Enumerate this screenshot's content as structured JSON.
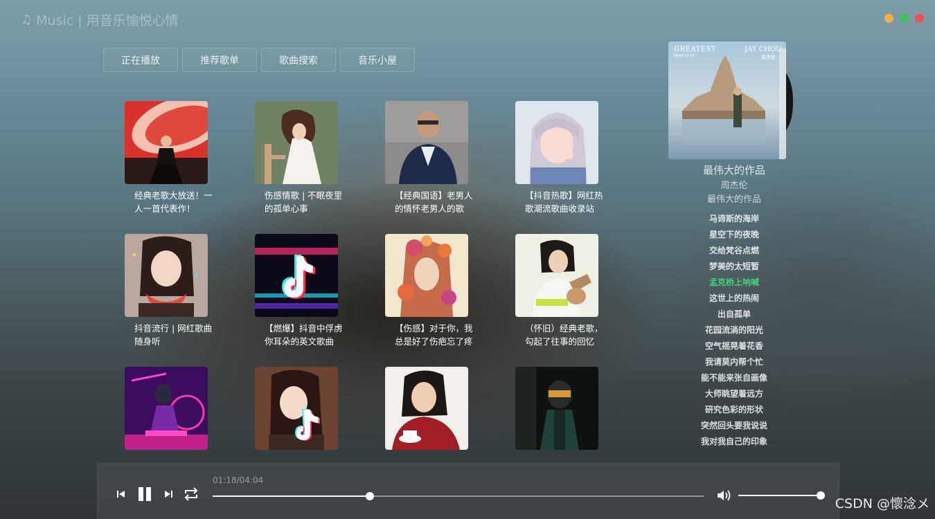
{
  "app": {
    "title": "Music | 用音乐愉悦心情",
    "window_controls": [
      "minimize",
      "maximize",
      "close"
    ]
  },
  "tabs": [
    {
      "label": "正在播放"
    },
    {
      "label": "推荐歌单"
    },
    {
      "label": "歌曲搜索"
    },
    {
      "label": "音乐小屋"
    }
  ],
  "playlists": [
    {
      "title": "经典老歌大放送！一人一首代表作！"
    },
    {
      "title": "伤感情歌 | 不眠夜里的孤单心事"
    },
    {
      "title": "【经典国语】老男人的情怀老男人的歌"
    },
    {
      "title": "【抖音热歌】网红热歌潮流歌曲收录站"
    },
    {
      "title": "抖音流行 | 网红歌曲随身听"
    },
    {
      "title": "【燃爆】抖音中俘虏你耳朵的英文歌曲"
    },
    {
      "title": "【伤感】对于你，我总是好了伤疤忘了疼"
    },
    {
      "title": "（怀旧）经典老歌，勾起了往事的回忆"
    },
    {
      "title": ""
    },
    {
      "title": ""
    },
    {
      "title": ""
    },
    {
      "title": ""
    }
  ],
  "now_playing": {
    "cover_text_left": "GREATEST",
    "cover_subtext_left": "WORKS OF ART",
    "cover_text_right": "JAY CHOU",
    "cover_subtext_right": "周杰伦",
    "title": "最伟大的作品",
    "artist": "周杰伦",
    "album": "最伟大的作品"
  },
  "song_list": [
    {
      "name": "马谛斯的海岸",
      "active": false
    },
    {
      "name": "星空下的夜晚",
      "active": false
    },
    {
      "name": "交给梵谷点燃",
      "active": false
    },
    {
      "name": "梦美的太短暂",
      "active": false
    },
    {
      "name": "孟克桥上呐喊",
      "active": true
    },
    {
      "name": "这世上的热闹",
      "active": false
    },
    {
      "name": "出自孤单",
      "active": false
    },
    {
      "name": "花园流淌的阳光",
      "active": false
    },
    {
      "name": "空气摇晃着花香",
      "active": false
    },
    {
      "name": "我请莫内帮个忙",
      "active": false
    },
    {
      "name": "能不能来张自画像",
      "active": false
    },
    {
      "name": "大师眺望着远方",
      "active": false
    },
    {
      "name": "研究色彩的形状",
      "active": false
    },
    {
      "name": "突然回头要我说说",
      "active": false
    },
    {
      "name": "我对我自己的印象",
      "active": false
    },
    {
      "name": "",
      "active": false
    }
  ],
  "player": {
    "time": "01:18/04:04",
    "current_seconds": 78,
    "total_seconds": 244,
    "volume": 1.0,
    "state": "playing"
  },
  "watermark": "CSDN @懷淰メ",
  "colors": {
    "accent": "#3ed27a",
    "win_min": "#f3b43f",
    "win_max": "#3fc24e",
    "win_close": "#f0524e"
  }
}
